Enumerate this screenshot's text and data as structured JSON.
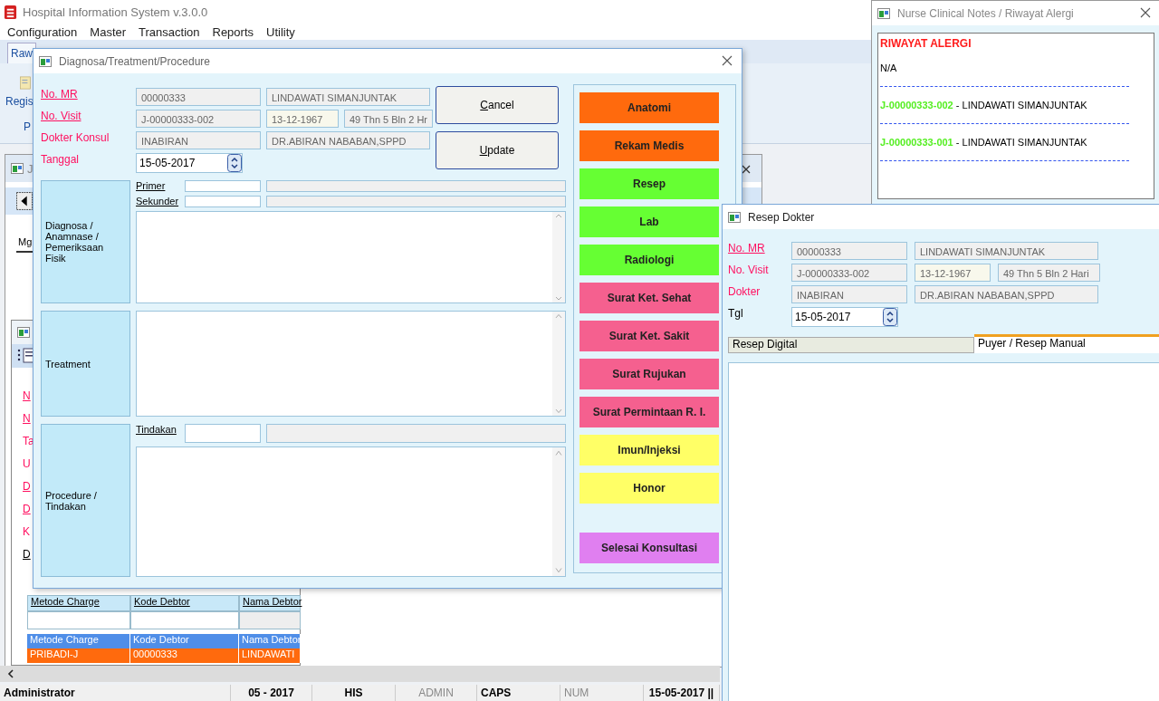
{
  "app": {
    "title": "Hospital Information System v.3.0.0",
    "menu": [
      "Configuration",
      "Master",
      "Transaction",
      "Reports",
      "Utility"
    ],
    "ribbon_tabs": [
      {
        "label": "Raw",
        "selected": true
      }
    ],
    "ribbon_item": "Regis",
    "ribbon_group": "P"
  },
  "background_window": {
    "title": "J",
    "tab": "Mg",
    "labels": [
      {
        "text": "N",
        "kind": "link"
      },
      {
        "text": "N",
        "kind": "link"
      },
      {
        "text": "Ta",
        "kind": "label"
      },
      {
        "text": "U",
        "kind": "label"
      },
      {
        "text": "D",
        "kind": "link"
      },
      {
        "text": "D",
        "kind": "link"
      },
      {
        "text": "K",
        "kind": "label"
      },
      {
        "text": "D",
        "kind": "black-link"
      }
    ],
    "charge_table": {
      "columns": [
        "Metode Charge",
        "Kode Debtor",
        "Nama Debtor"
      ]
    },
    "debtor_table": {
      "columns": [
        "Metode Charge",
        "Kode Debtor",
        "Nama Debtor"
      ],
      "rows": [
        {
          "cells": [
            "PRIBADI-J",
            "00000333",
            "LINDAWATI"
          ],
          "selected": true
        }
      ]
    }
  },
  "dialog": {
    "title": "Diagnosa/Treatment/Procedure",
    "header": [
      {
        "label": "No. MR",
        "kind": "link",
        "fields": [
          "00000333",
          "LINDAWATI SIMANJUNTAK"
        ]
      },
      {
        "label": "No. Visit",
        "kind": "link",
        "fields": [
          "J-00000333-002",
          "13-12-1967",
          "49 Thn 5 Bln 2 Hr"
        ]
      },
      {
        "label": "Dokter Konsul",
        "kind": "label",
        "fields": [
          "INABIRAN",
          "DR.ABIRAN NABABAN,SPPD"
        ]
      }
    ],
    "date_label": "Tanggal",
    "date": "15-05-2017",
    "buttons": [
      "Cancel",
      "Update"
    ],
    "sections": [
      {
        "title": "Diagnosa / Anamnase / Pemeriksaan Fisik",
        "codes": [
          "Primer",
          "Sekunder"
        ]
      },
      {
        "title": "Treatment"
      },
      {
        "title": "Procedure / Tindakan",
        "codes": [
          "Tindakan"
        ]
      }
    ],
    "actions": [
      {
        "label": "Anatomi",
        "color": "#ff6a0d"
      },
      {
        "label": "Rekam Medis",
        "color": "#ff6a0d"
      },
      {
        "label": "Resep",
        "color": "#66ff33"
      },
      {
        "label": "Lab",
        "color": "#66ff33"
      },
      {
        "label": "Radiologi",
        "color": "#66ff33"
      },
      {
        "label": "Surat Ket. Sehat",
        "color": "#f5608f"
      },
      {
        "label": "Surat Ket. Sakit",
        "color": "#f5608f"
      },
      {
        "label": "Surat Rujukan",
        "color": "#f5608f"
      },
      {
        "label": "Surat Permintaan R. I.",
        "color": "#f5608f"
      },
      {
        "label": "Imun/Injeksi",
        "color": "#ffff66"
      },
      {
        "label": "Honor",
        "color": "#ffff66"
      },
      {
        "label": "Selesai Konsultasi",
        "color": "#e07ff0"
      }
    ]
  },
  "nurse_notes": {
    "title": "Nurse Clinical Notes / Riwayat Alergi",
    "heading": "RIWAYAT ALERGI",
    "allergy": "N/A",
    "visits": [
      {
        "visit": "J-00000333-002",
        "name": " - LINDAWATI SIMANJUNTAK"
      },
      {
        "visit": "J-00000333-001",
        "name": " - LINDAWATI SIMANJUNTAK"
      }
    ]
  },
  "resep": {
    "title": "Resep Dokter",
    "header": [
      {
        "label": "No. MR",
        "kind": "link",
        "fields": [
          "00000333",
          "LINDAWATI SIMANJUNTAK"
        ]
      },
      {
        "label": "No. Visit",
        "kind": "label",
        "fields": [
          "J-00000333-002",
          "13-12-1967",
          "49 Thn 5 Bln 2 Hari"
        ]
      },
      {
        "label": "Dokter",
        "kind": "label",
        "fields": [
          "INABIRAN",
          "DR.ABIRAN NABABAN,SPPD"
        ]
      }
    ],
    "date_label": "Tgl",
    "date": "15-05-2017",
    "tabs": [
      {
        "label": "Resep Digital",
        "selected": false
      },
      {
        "label": "Puyer / Resep Manual",
        "selected": true
      }
    ]
  },
  "status_bar": [
    {
      "text": "Administrator",
      "disabled": false
    },
    {
      "text": "05 - 2017",
      "disabled": false
    },
    {
      "text": "HIS",
      "disabled": false
    },
    {
      "text": "ADMIN",
      "disabled": true
    },
    {
      "text": "CAPS",
      "disabled": false
    },
    {
      "text": "NUM",
      "disabled": true
    },
    {
      "text": "15-05-2017 ||",
      "disabled": false
    }
  ]
}
